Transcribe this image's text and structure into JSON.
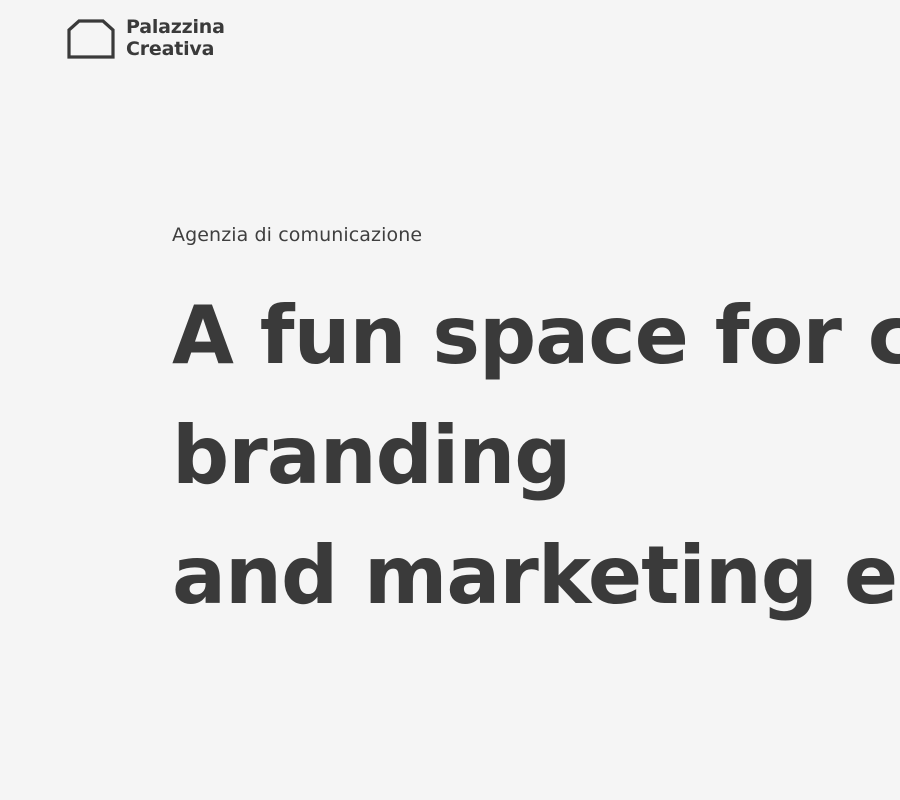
{
  "header": {
    "logo": {
      "icon": "house-outline-icon",
      "line1": "Palazzina",
      "line2": "Creativa"
    }
  },
  "hero": {
    "eyebrow": "Agenzia di comunicazione",
    "headline_lines": [
      "A fun space for c",
      "branding",
      "and marketing e"
    ]
  },
  "colors": {
    "background": "#f5f5f5",
    "text": "#3a3a3a"
  }
}
